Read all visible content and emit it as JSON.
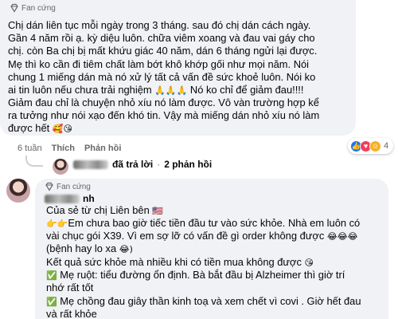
{
  "comment1": {
    "badge": "Fan cứng",
    "lines": [
      "Chị dán liên tục mỗi ngày trong 3 tháng. sau đó chị dán cách ngày.",
      "Gần 4 năm rồi ạ. kỳ diệu luôn. chữa viêm xoang và đau vai gáy cho",
      "chị. còn Ba chị bị mất khứu giác 40 năm, dán 6 tháng ngửi lại được.",
      "Mẹ thì ko cần đi tiêm chất làm bớt khô khớp gối như mọi năm. Nói",
      "chung 1 miếng dán mà nó xử lý tất cả vấn đề sức khoẻ luôn. Nói ko",
      "ai tin luôn nếu chưa trải nghiệm ",
      "Giảm đau chỉ là chuyện nhỏ xíu nó làm được. Vô vàn trường hợp kể",
      "ra tưởng như nói xạo đến khó tin. Vậy mà miếng dán nhỏ xíu nó làm",
      "được hết "
    ],
    "line6_emoji": "🙏🙏🙏",
    "line6_tail": " Nó ko chỉ để giảm đau!!!!",
    "line9_emoji": "🥰😘",
    "meta": {
      "time": "6 tuần",
      "like": "Thích",
      "reply": "Phản hồi"
    },
    "reactions": {
      "count": "4",
      "icons": [
        "like",
        "love",
        "haha"
      ]
    },
    "reply_summary": {
      "action": "đã trả lời",
      "count_text": "2 phản hồi"
    }
  },
  "comment2": {
    "badge": "Fan cứng",
    "name_suffix": "nh",
    "lines": [
      "Của sẻ từ chị Liên bên ",
      "Em chưa bao giờ tiếc tiền đầu tư vào sức khỏe. Nhà em luôn có",
      "vài chục gói X39. Vì em sợ lỡ có vấn đề gì order không được ",
      "(bệnh hay lo xa ",
      "Kết quả sức khỏe mà nhiều khi có tiền mua không được ",
      "Mẹ ruột: tiểu đường ổn định. Bà bắt đầu bị Alzheimer thì giờ trí",
      "nhớ rất tốt",
      "Mẹ chồng đau giây thần kinh toạ và xem chết vì covi . Giờ hết đau",
      "và rất khỏe"
    ],
    "line1_emoji": "🇺🇸",
    "line2_emoji": "👉👉",
    "line3_emoji": "😂😂😂",
    "line4_emoji": "😂)",
    "line5_emoji": "😘",
    "check_emoji": "✅"
  },
  "colors": {
    "bubble": "#f0f2f5",
    "meta": "#65676b",
    "like": "#1877f2",
    "love": "#f33e58",
    "haha": "#f7b125"
  },
  "icons": [
    "gem-icon",
    "like-reaction-icon",
    "love-reaction-icon",
    "haha-reaction-icon",
    "avatar"
  ]
}
